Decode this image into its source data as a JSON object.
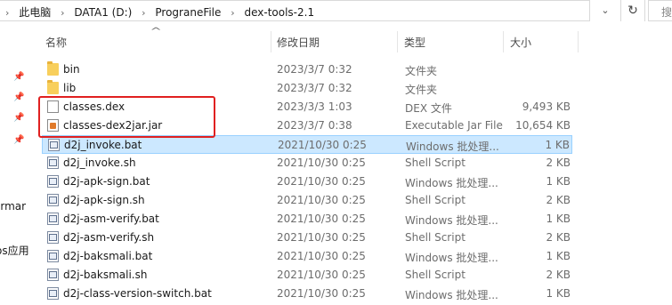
{
  "address": {
    "crumbs": [
      "此电脑",
      "DATA1 (D:)",
      "PrograneFile",
      "dex-tools-2.1"
    ],
    "refresh_glyph": "↻",
    "search_partial": "搜"
  },
  "nav": {
    "partial_text_1": "ermar",
    "partial_text_2": "os应用"
  },
  "columns": {
    "name": "名称",
    "date": "修改日期",
    "type": "类型",
    "size": "大小"
  },
  "files": [
    {
      "name": "bin",
      "date": "2023/3/7 0:32",
      "type": "文件夹",
      "size": "",
      "icon": "folder-icon"
    },
    {
      "name": "lib",
      "date": "2023/3/7 0:32",
      "type": "文件夹",
      "size": "",
      "icon": "folder-icon"
    },
    {
      "name": "classes.dex",
      "date": "2023/3/3 1:03",
      "type": "DEX 文件",
      "size": "9,493 KB",
      "icon": "document-icon"
    },
    {
      "name": "classes-dex2jar.jar",
      "date": "2023/3/7 0:38",
      "type": "Executable Jar File",
      "size": "10,654 KB",
      "icon": "jar-icon"
    },
    {
      "name": "d2j_invoke.bat",
      "date": "2021/10/30 0:25",
      "type": "Windows 批处理...",
      "size": "1 KB",
      "icon": "batch-file-icon"
    },
    {
      "name": "d2j_invoke.sh",
      "date": "2021/10/30 0:25",
      "type": "Shell Script",
      "size": "2 KB",
      "icon": "script-file-icon"
    },
    {
      "name": "d2j-apk-sign.bat",
      "date": "2021/10/30 0:25",
      "type": "Windows 批处理...",
      "size": "1 KB",
      "icon": "batch-file-icon"
    },
    {
      "name": "d2j-apk-sign.sh",
      "date": "2021/10/30 0:25",
      "type": "Shell Script",
      "size": "2 KB",
      "icon": "script-file-icon"
    },
    {
      "name": "d2j-asm-verify.bat",
      "date": "2021/10/30 0:25",
      "type": "Windows 批处理...",
      "size": "1 KB",
      "icon": "batch-file-icon"
    },
    {
      "name": "d2j-asm-verify.sh",
      "date": "2021/10/30 0:25",
      "type": "Shell Script",
      "size": "2 KB",
      "icon": "script-file-icon"
    },
    {
      "name": "d2j-baksmali.bat",
      "date": "2021/10/30 0:25",
      "type": "Windows 批处理...",
      "size": "1 KB",
      "icon": "batch-file-icon"
    },
    {
      "name": "d2j-baksmali.sh",
      "date": "2021/10/30 0:25",
      "type": "Shell Script",
      "size": "2 KB",
      "icon": "script-file-icon"
    },
    {
      "name": "d2j-class-version-switch.bat",
      "date": "2021/10/30 0:25",
      "type": "Windows 批处理...",
      "size": "1 KB",
      "icon": "batch-file-icon"
    }
  ],
  "selected_file": "d2j_invoke.bat",
  "highlight_color": "#e02020"
}
